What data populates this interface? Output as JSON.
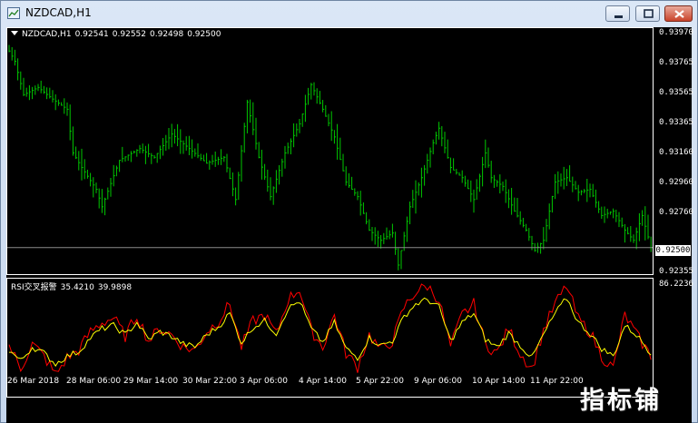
{
  "window": {
    "title": "NZDCAD,H1",
    "icons": {
      "app": "chart-window-icon",
      "minimize": "minimize-icon",
      "maximize": "maximize-icon",
      "close": "close-icon"
    }
  },
  "price_pane": {
    "symbol": "NZDCAD,H1",
    "ohlc": [
      "0.92541",
      "0.92552",
      "0.92498",
      "0.92500"
    ],
    "line_color": "#00c800",
    "current_price": "0.92500",
    "y_labels": [
      "0.93970",
      "0.93765",
      "0.93565",
      "0.93365",
      "0.93160",
      "0.92960",
      "0.92760",
      "0.92500",
      "0.92355"
    ]
  },
  "rsi_pane": {
    "title": "RSI交叉报警",
    "value1": "35.4210",
    "value2": "39.9898",
    "max_label": "86.2236",
    "colors": {
      "fast": "#ff0000",
      "slow": "#ffff00"
    }
  },
  "x_axis": {
    "labels": [
      "26 Mar 2018",
      "28 Mar 06:00",
      "29 Mar 14:00",
      "30 Mar 22:00",
      "3 Apr 06:00",
      "4 Apr 14:00",
      "5 Apr 22:00",
      "9 Apr 06:00",
      "10 Apr 14:00",
      "11 Apr 22:00"
    ]
  },
  "watermark": "指标铺",
  "chart_data": {
    "type": "bar",
    "title": "NZDCAD,H1",
    "timeframe": "H1",
    "price_range": [
      0.92355,
      0.9397
    ],
    "approx_price_path": [
      [
        0,
        0.9385
      ],
      [
        2,
        0.9378
      ],
      [
        5,
        0.9355
      ],
      [
        10,
        0.936
      ],
      [
        15,
        0.9352
      ],
      [
        20,
        0.9345
      ],
      [
        22,
        0.9315
      ],
      [
        25,
        0.9305
      ],
      [
        30,
        0.929
      ],
      [
        32,
        0.9278
      ],
      [
        38,
        0.931
      ],
      [
        45,
        0.9318
      ],
      [
        50,
        0.9312
      ],
      [
        56,
        0.9328
      ],
      [
        62,
        0.9318
      ],
      [
        68,
        0.9308
      ],
      [
        74,
        0.9312
      ],
      [
        78,
        0.9283
      ],
      [
        82,
        0.935
      ],
      [
        86,
        0.9312
      ],
      [
        90,
        0.9285
      ],
      [
        95,
        0.9315
      ],
      [
        100,
        0.9335
      ],
      [
        104,
        0.9362
      ],
      [
        108,
        0.9345
      ],
      [
        112,
        0.9326
      ],
      [
        116,
        0.9295
      ],
      [
        120,
        0.9285
      ],
      [
        124,
        0.9262
      ],
      [
        128,
        0.9255
      ],
      [
        132,
        0.926
      ],
      [
        134,
        0.9238
      ],
      [
        138,
        0.9278
      ],
      [
        142,
        0.9298
      ],
      [
        146,
        0.9322
      ],
      [
        148,
        0.9332
      ],
      [
        152,
        0.9305
      ],
      [
        156,
        0.9298
      ],
      [
        160,
        0.9283
      ],
      [
        164,
        0.9315
      ],
      [
        166,
        0.9298
      ],
      [
        170,
        0.9292
      ],
      [
        174,
        0.9275
      ],
      [
        178,
        0.9262
      ],
      [
        181,
        0.9248
      ],
      [
        184,
        0.9255
      ],
      [
        188,
        0.9295
      ],
      [
        192,
        0.9298
      ],
      [
        196,
        0.9288
      ],
      [
        200,
        0.929
      ],
      [
        204,
        0.9272
      ],
      [
        208,
        0.9275
      ],
      [
        212,
        0.9262
      ],
      [
        215,
        0.9255
      ],
      [
        218,
        0.9272
      ],
      [
        221,
        0.925
      ]
    ],
    "current": 0.925,
    "rsi": {
      "max": 86.2236,
      "series": [
        {
          "name": "",
          "color": "#ff0000",
          "approx_path": [
            [
              0,
              45
            ],
            [
              4,
              30
            ],
            [
              8,
              46
            ],
            [
              12,
              38
            ],
            [
              16,
              26
            ],
            [
              20,
              37
            ],
            [
              24,
              42
            ],
            [
              28,
              54
            ],
            [
              32,
              60
            ],
            [
              36,
              63
            ],
            [
              40,
              51
            ],
            [
              44,
              65
            ],
            [
              48,
              48
            ],
            [
              52,
              56
            ],
            [
              56,
              52
            ],
            [
              60,
              44
            ],
            [
              64,
              42
            ],
            [
              68,
              54
            ],
            [
              72,
              61
            ],
            [
              76,
              72
            ],
            [
              80,
              44
            ],
            [
              84,
              61
            ],
            [
              88,
              65
            ],
            [
              92,
              52
            ],
            [
              96,
              75
            ],
            [
              100,
              82
            ],
            [
              104,
              55
            ],
            [
              108,
              44
            ],
            [
              112,
              65
            ],
            [
              116,
              40
            ],
            [
              120,
              31
            ],
            [
              124,
              52
            ],
            [
              128,
              42
            ],
            [
              132,
              48
            ],
            [
              136,
              70
            ],
            [
              140,
              80
            ],
            [
              144,
              84
            ],
            [
              148,
              75
            ],
            [
              152,
              44
            ],
            [
              156,
              65
            ],
            [
              160,
              72
            ],
            [
              164,
              46
            ],
            [
              168,
              40
            ],
            [
              172,
              56
            ],
            [
              176,
              40
            ],
            [
              180,
              30
            ],
            [
              184,
              55
            ],
            [
              188,
              72
            ],
            [
              192,
              84
            ],
            [
              196,
              62
            ],
            [
              200,
              54
            ],
            [
              204,
              38
            ],
            [
              208,
              30
            ],
            [
              212,
              65
            ],
            [
              216,
              52
            ],
            [
              221,
              38
            ]
          ]
        },
        {
          "name": "",
          "color": "#ffff00",
          "approx_path": [
            [
              0,
              42
            ],
            [
              4,
              35
            ],
            [
              8,
              44
            ],
            [
              12,
              40
            ],
            [
              16,
              33
            ],
            [
              20,
              38
            ],
            [
              24,
              41
            ],
            [
              28,
              50
            ],
            [
              32,
              56
            ],
            [
              36,
              58
            ],
            [
              40,
              52
            ],
            [
              44,
              60
            ],
            [
              48,
              49
            ],
            [
              52,
              54
            ],
            [
              56,
              51
            ],
            [
              60,
              46
            ],
            [
              64,
              44
            ],
            [
              68,
              52
            ],
            [
              72,
              57
            ],
            [
              76,
              66
            ],
            [
              80,
              47
            ],
            [
              84,
              57
            ],
            [
              88,
              61
            ],
            [
              92,
              53
            ],
            [
              96,
              69
            ],
            [
              100,
              74
            ],
            [
              104,
              56
            ],
            [
              108,
              47
            ],
            [
              112,
              60
            ],
            [
              116,
              43
            ],
            [
              120,
              37
            ],
            [
              124,
              50
            ],
            [
              128,
              45
            ],
            [
              132,
              48
            ],
            [
              136,
              64
            ],
            [
              140,
              72
            ],
            [
              144,
              75
            ],
            [
              148,
              70
            ],
            [
              152,
              48
            ],
            [
              156,
              60
            ],
            [
              160,
              66
            ],
            [
              164,
              49
            ],
            [
              168,
              44
            ],
            [
              172,
              53
            ],
            [
              176,
              45
            ],
            [
              180,
              37
            ],
            [
              184,
              52
            ],
            [
              188,
              66
            ],
            [
              192,
              76
            ],
            [
              196,
              60
            ],
            [
              200,
              53
            ],
            [
              204,
              43
            ],
            [
              208,
              38
            ],
            [
              212,
              58
            ],
            [
              216,
              52
            ],
            [
              221,
              40
            ]
          ]
        }
      ]
    },
    "x_tick_labels": [
      "26 Mar 2018",
      "28 Mar 06:00",
      "29 Mar 14:00",
      "30 Mar 22:00",
      "3 Apr 06:00",
      "4 Apr 14:00",
      "5 Apr 22:00",
      "9 Apr 06:00",
      "10 Apr 14:00",
      "11 Apr 22:00"
    ]
  }
}
